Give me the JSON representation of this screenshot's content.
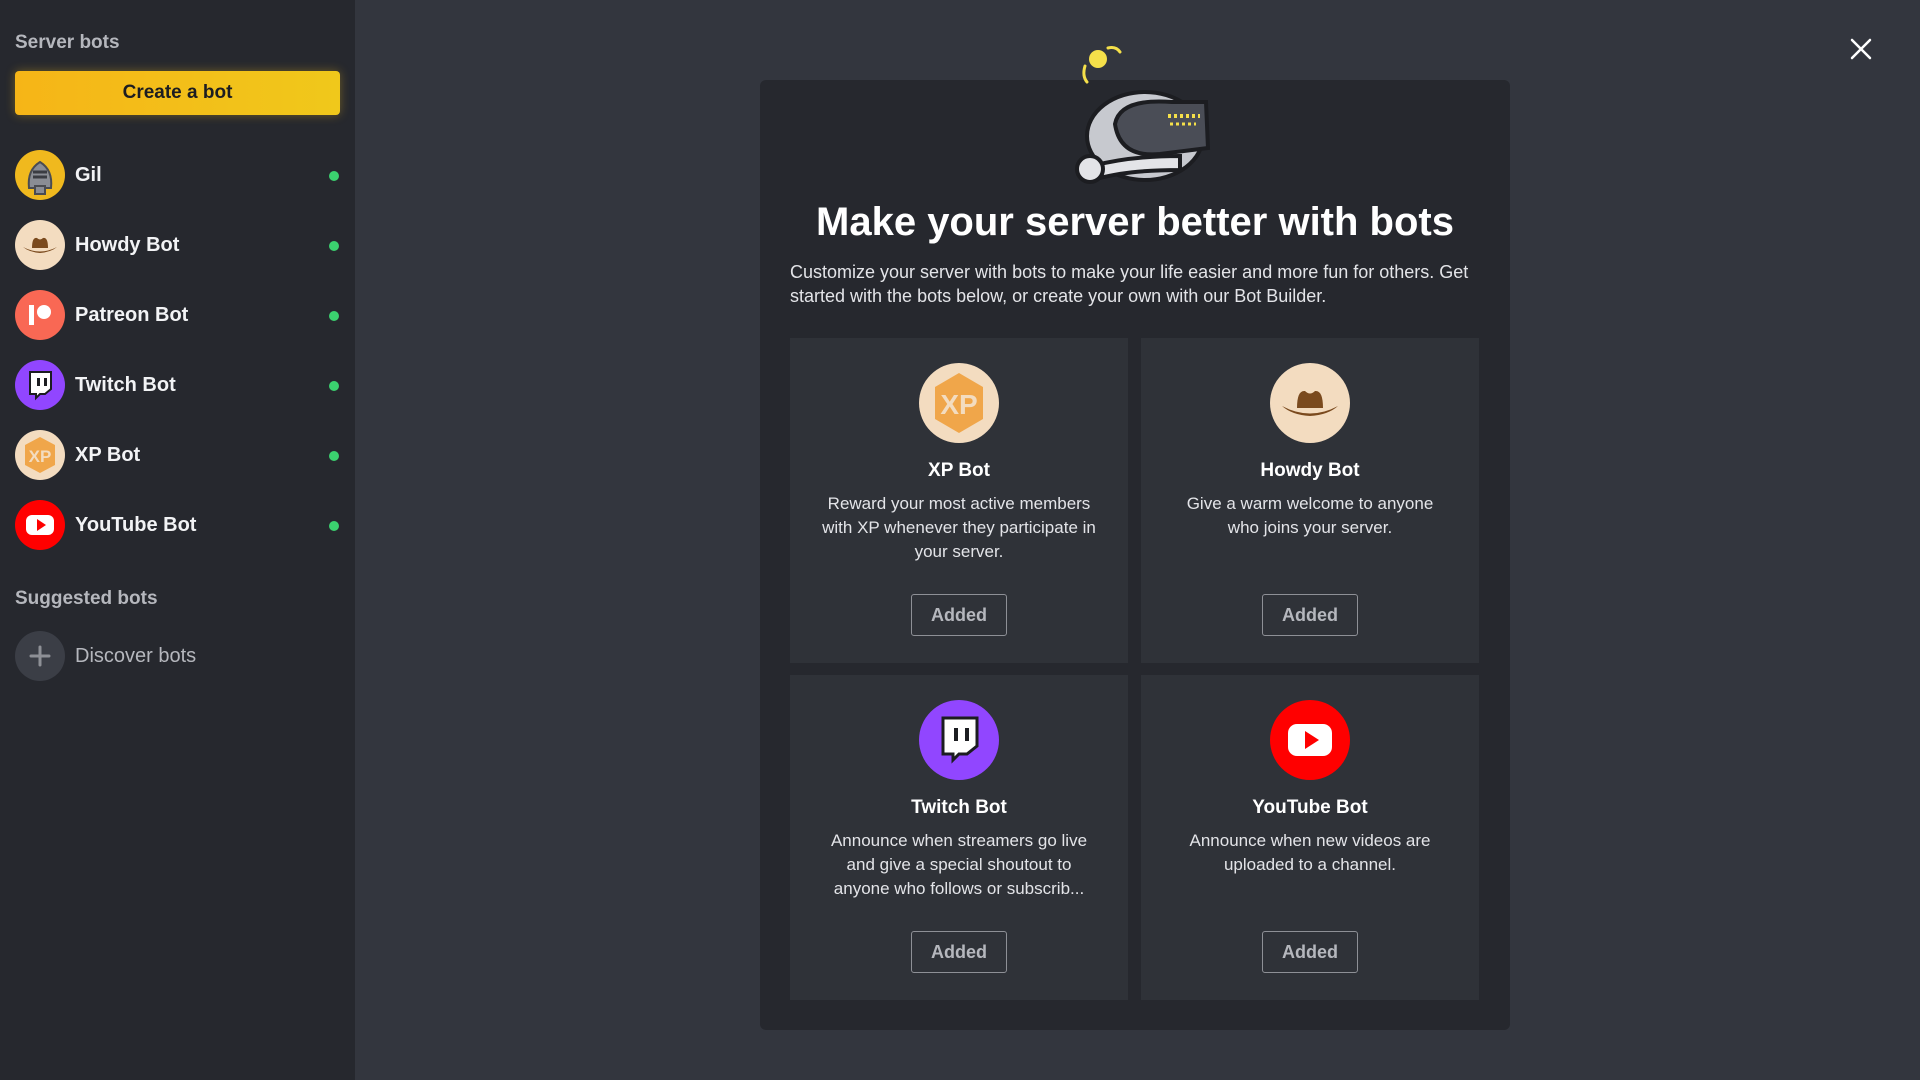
{
  "sidebar": {
    "server_bots_heading": "Server bots",
    "create_button": "Create a bot",
    "bots": [
      {
        "name": "Gil",
        "icon": "knight-helmet-icon",
        "online": true
      },
      {
        "name": "Howdy Bot",
        "icon": "cowboy-hat-icon",
        "online": true
      },
      {
        "name": "Patreon Bot",
        "icon": "patreon-icon",
        "online": true
      },
      {
        "name": "Twitch Bot",
        "icon": "twitch-icon",
        "online": true
      },
      {
        "name": "XP Bot",
        "icon": "xp-icon",
        "online": true
      },
      {
        "name": "YouTube Bot",
        "icon": "youtube-icon",
        "online": true
      }
    ],
    "suggested_heading": "Suggested bots",
    "discover_label": "Discover bots"
  },
  "modal": {
    "title": "Make your server better with bots",
    "description": "Customize your server with bots to make your life easier and more fun for others. Get started with the bots below, or create your own with our Bot Builder.",
    "cards": [
      {
        "title": "XP Bot",
        "description": "Reward your most active members with XP whenever they participate in your server.",
        "button": "Added",
        "icon": "xp-icon"
      },
      {
        "title": "Howdy Bot",
        "description": "Give a warm welcome to anyone who joins your server.",
        "button": "Added",
        "icon": "cowboy-hat-icon"
      },
      {
        "title": "Twitch Bot",
        "description": "Announce when streamers go live and give a special shoutout to anyone who follows or subscrib...",
        "button": "Added",
        "icon": "twitch-icon"
      },
      {
        "title": "YouTube Bot",
        "description": "Announce when new videos are uploaded to a channel.",
        "button": "Added",
        "icon": "youtube-icon"
      }
    ]
  },
  "colors": {
    "accent_yellow": "#f6b517",
    "online_green": "#3bd16f",
    "twitch_purple": "#9146ff",
    "youtube_red": "#ff0000",
    "patreon_red": "#f96854",
    "xp_orange": "#f0a64a",
    "howdy_tan": "#f3dcc0"
  }
}
